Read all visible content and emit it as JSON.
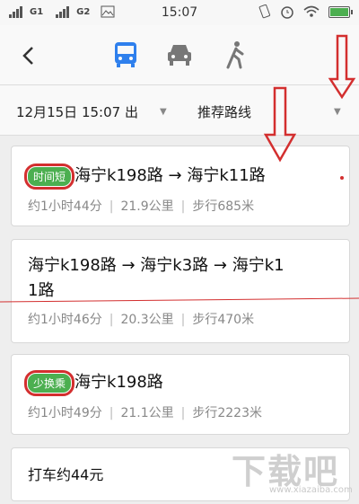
{
  "status_bar": {
    "sim1": "G1",
    "sim2": "G2",
    "time": "15:07"
  },
  "mode_bar": {
    "modes": [
      {
        "icon": "bus-icon",
        "active": true
      },
      {
        "icon": "car-icon",
        "active": false
      },
      {
        "icon": "walk-icon",
        "active": false
      }
    ]
  },
  "options": {
    "departure": "12月15日 15:07 出",
    "route_pref": "推荐路线"
  },
  "routes": [
    {
      "badge": "时间短",
      "title": "海宁k198路 → 海宁k11路",
      "duration": "约1小时44分",
      "distance": "21.9公里",
      "walk": "步行685米"
    },
    {
      "badge": "",
      "title_line1": "海宁k198路 → 海宁k3路 → 海宁k1",
      "title_line2": "1路",
      "duration": "约1小时46分",
      "distance": "20.3公里",
      "walk": "步行470米"
    },
    {
      "badge": "少换乘",
      "title": "海宁k198路",
      "duration": "约1小时49分",
      "distance": "21.1公里",
      "walk": "步行2223米"
    }
  ],
  "taxi": {
    "label": "打车约44元"
  },
  "watermark": {
    "text": "下载吧",
    "sub": "www.xiazaiba.com"
  },
  "colors": {
    "accent_blue": "#2f80ed",
    "badge_green": "#4caf50",
    "annotation_red": "#d32f2f"
  }
}
